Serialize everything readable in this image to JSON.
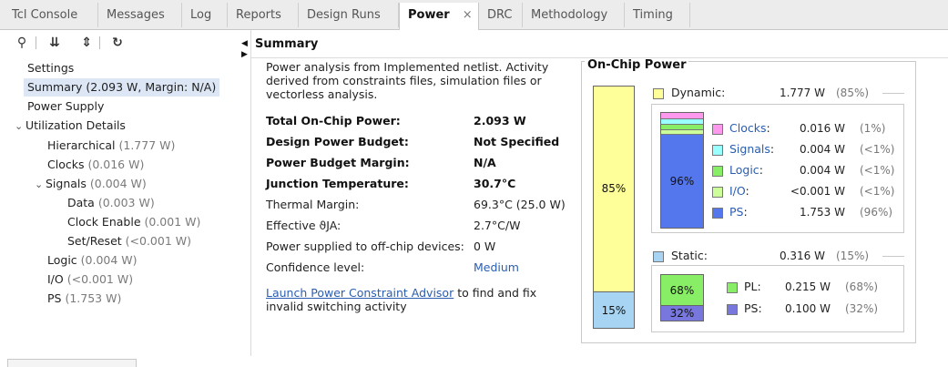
{
  "tabs": [
    {
      "label": "Tcl Console",
      "active": false
    },
    {
      "label": "Messages",
      "active": false
    },
    {
      "label": "Log",
      "active": false
    },
    {
      "label": "Reports",
      "active": false
    },
    {
      "label": "Design Runs",
      "active": false
    },
    {
      "label": "Power",
      "active": true
    },
    {
      "label": "DRC",
      "active": false
    },
    {
      "label": "Methodology",
      "active": false
    },
    {
      "label": "Timing",
      "active": false
    }
  ],
  "tab_close": "×",
  "toolbar": {
    "search": "⚲",
    "collapse": "⇊",
    "expand": "⇕",
    "refresh": "↻"
  },
  "tree": {
    "settings": "Settings",
    "summary": "Summary (2.093 W, Margin: N/A)",
    "power_supply": "Power Supply",
    "utilization": "Utilization Details",
    "hierarchical": {
      "label": "Hierarchical",
      "value": "(1.777 W)"
    },
    "clocks": {
      "label": "Clocks",
      "value": "(0.016 W)"
    },
    "signals": {
      "label": "Signals",
      "value": "(0.004 W)"
    },
    "data": {
      "label": "Data",
      "value": "(0.003 W)"
    },
    "clock_enable": {
      "label": "Clock Enable",
      "value": "(0.001 W)"
    },
    "set_reset": {
      "label": "Set/Reset",
      "value": "(<0.001 W)"
    },
    "logic": {
      "label": "Logic",
      "value": "(0.004 W)"
    },
    "io": {
      "label": "I/O",
      "value": "(<0.001 W)"
    },
    "ps": {
      "label": "PS",
      "value": "(1.753 W)"
    }
  },
  "summary": {
    "title": "Summary",
    "intro": "Power analysis from Implemented netlist. Activity derived from constraints files, simulation files or vectorless analysis.",
    "rows": [
      {
        "key": "Total On-Chip Power:",
        "value": "2.093 W",
        "bold": true
      },
      {
        "key": "Design Power Budget:",
        "value": "Not Specified",
        "bold": true
      },
      {
        "key": "Power Budget Margin:",
        "value": "N/A",
        "bold": true
      },
      {
        "key": "Junction Temperature:",
        "value": "30.7°C",
        "bold": true
      },
      {
        "key": "Thermal Margin:",
        "value": "69.3°C (25.0 W)",
        "bold": false
      },
      {
        "key": "Effective ϑJA:",
        "value": "2.7°C/W",
        "bold": false
      },
      {
        "key": "Power supplied to off-chip devices:",
        "value": "0 W",
        "bold": false
      },
      {
        "key": "Confidence level:",
        "value": "Medium",
        "bold": false,
        "link": true
      }
    ],
    "advisor_link": "Launch Power Constraint Advisor",
    "advisor_text": " to find and fix invalid switching activity"
  },
  "onchip": {
    "title": "On-Chip Power",
    "dynamic": {
      "label": "Dynamic:",
      "value": "1.777 W",
      "pct": "(85%)",
      "fraction": 0.85,
      "bar_label": "85%",
      "color": "#ffff99"
    },
    "static": {
      "label": "Static:",
      "value": "0.316 W",
      "pct": "(15%)",
      "fraction": 0.15,
      "bar_label": "15%",
      "color": "#a6d4f2"
    },
    "dynamic_breakdown": {
      "bar_label": "96%",
      "items": [
        {
          "label": "Clocks",
          "value": "0.016 W",
          "pct": "(1%)",
          "fraction": 0.01,
          "color": "#ff99ee"
        },
        {
          "label": "Signals",
          "value": "0.004 W",
          "pct": "(<1%)",
          "fraction": 0.005,
          "color": "#99ffff"
        },
        {
          "label": "Logic",
          "value": "0.004 W",
          "pct": "(<1%)",
          "fraction": 0.005,
          "color": "#88ee66"
        },
        {
          "label": "I/O",
          "value": "<0.001 W",
          "pct": "(<1%)",
          "fraction": 0.001,
          "color": "#ccff99"
        },
        {
          "label": "PS",
          "value": "1.753 W",
          "pct": "(96%)",
          "fraction": 0.96,
          "color": "#5577ee"
        }
      ]
    },
    "static_breakdown": {
      "items": [
        {
          "label": "PL:",
          "value": "0.215 W",
          "pct": "(68%)",
          "fraction": 0.68,
          "bar_label": "68%",
          "color": "#88ee66"
        },
        {
          "label": "PS:",
          "value": "0.100 W",
          "pct": "(32%)",
          "fraction": 0.32,
          "bar_label": "32%",
          "color": "#7777dd"
        }
      ]
    }
  }
}
